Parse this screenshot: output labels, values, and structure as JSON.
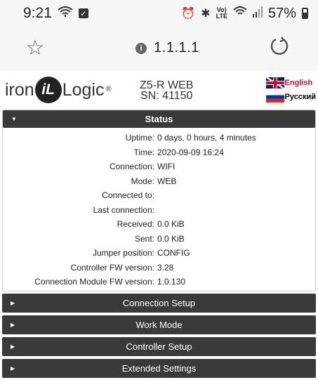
{
  "statusbar": {
    "time": "9:21",
    "battery_text": "57%",
    "volte_top": "Vo)",
    "volte_bottom": "LTE"
  },
  "browser": {
    "url": "1.1.1.1",
    "icons": [
      "star-icon",
      "info-icon",
      "reload-icon"
    ]
  },
  "header": {
    "logo_left": "iron",
    "logo_mid": "iL",
    "logo_right": "Logic",
    "logo_reg": "®",
    "device_model": "Z5-R WEB",
    "device_sn": "SN: 41150",
    "lang_en": "English",
    "lang_ru": "Русский"
  },
  "status": {
    "title": "Status",
    "rows": [
      {
        "label": "Uptime:",
        "value": "0 days, 0 hours, 4 minutes"
      },
      {
        "label": "Time:",
        "value": "2020-09-09 16:24"
      },
      {
        "label": "Connection:",
        "value": "WIFI"
      },
      {
        "label": "Mode:",
        "value": "WEB"
      },
      {
        "label": "Connected to:",
        "value": ""
      },
      {
        "label": "Last connection:",
        "value": ""
      },
      {
        "label": "Received:",
        "value": "0.0 KiB"
      },
      {
        "label": "Sent:",
        "value": "0.0 KiB"
      },
      {
        "label": "Jumper position:",
        "value": "CONFIG"
      },
      {
        "label": "Controller FW version:",
        "value": "3.28"
      },
      {
        "label": "Connection Module FW version:",
        "value": "1.0.130"
      }
    ]
  },
  "sections": [
    {
      "title": "Connection Setup"
    },
    {
      "title": "Work Mode"
    },
    {
      "title": "Controller Setup"
    },
    {
      "title": "Extended Settings"
    }
  ],
  "colors": {
    "panel_header": "#3a3a3a",
    "english_red": "#c8102e"
  }
}
